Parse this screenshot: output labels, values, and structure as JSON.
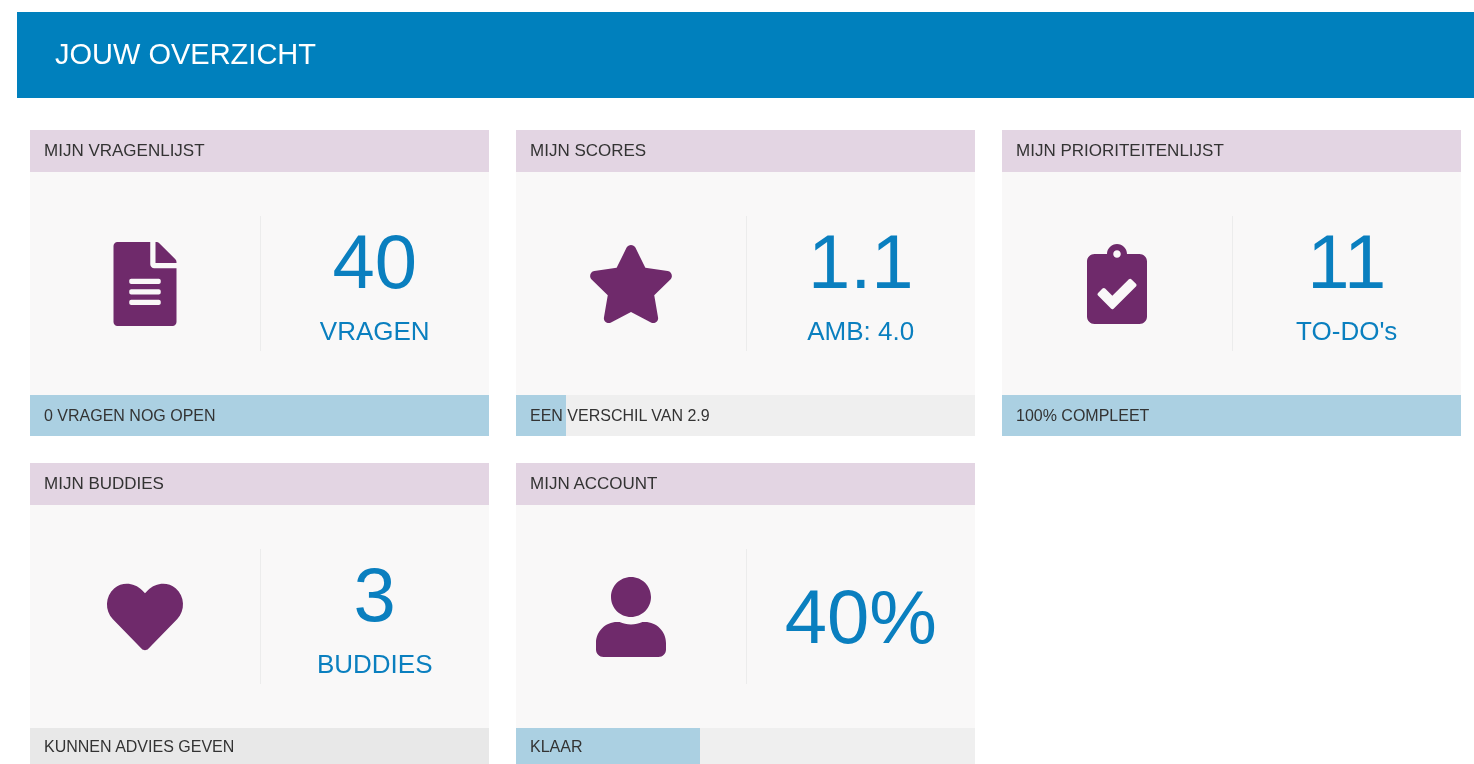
{
  "header": {
    "title": "JOUW OVERZICHT"
  },
  "cards": [
    {
      "title": "MIJN VRAGENLIJST",
      "value": "40",
      "label": "VRAGEN",
      "footer": {
        "text": "0 VRAGEN NOG OPEN",
        "level": 1
      }
    },
    {
      "title": "MIJN SCORES",
      "value": "1.1",
      "label": "AMB: 4.0",
      "footer": {
        "text": "EEN VERSCHIL VAN 2.9",
        "level": 0.11
      }
    },
    {
      "title": "MIJN PRIORITEITENLIJST",
      "value": "11",
      "label": "TO-DO's",
      "footer": {
        "text": "100% COMPLEET",
        "level": 1
      }
    },
    {
      "title": "MIJN BUDDIES",
      "value": "3",
      "label": "BUDDIES",
      "footer": {
        "text": "KUNNEN ADVIES GEVEN"
      }
    },
    {
      "title": "MIJN ACCOUNT",
      "value": "40%",
      "footer": {
        "text": "KLAAR",
        "level": 0.4
      }
    }
  ]
}
